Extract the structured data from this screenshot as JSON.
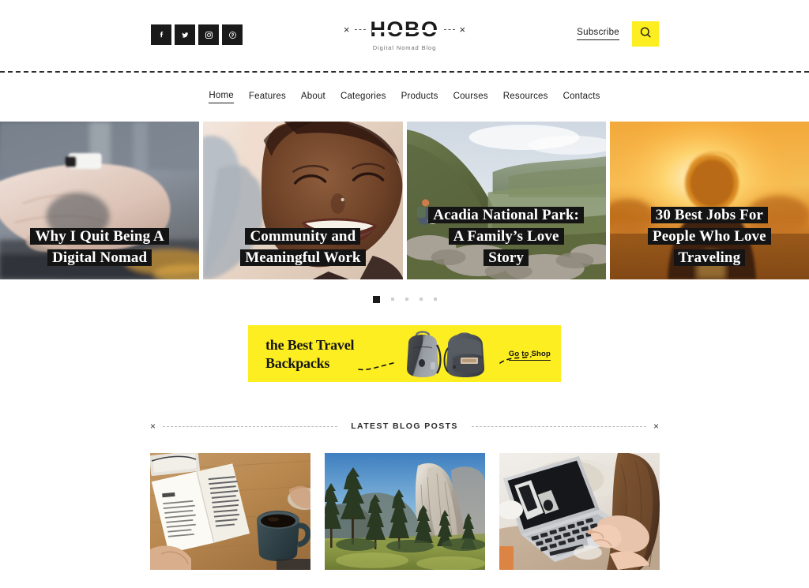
{
  "theme": {
    "accent": "#fdee21",
    "ink": "#1a1a1a",
    "muted": "#6f6f6f"
  },
  "header": {
    "social": [
      {
        "name": "facebook-icon",
        "label": "Facebook"
      },
      {
        "name": "twitter-icon",
        "label": "Twitter"
      },
      {
        "name": "instagram-icon",
        "label": "Instagram"
      },
      {
        "name": "pinterest-icon",
        "label": "Pinterest"
      }
    ],
    "logo": {
      "mark_left": "×",
      "mark_right": "×",
      "title": "HOBO",
      "tagline": "Digital Nomad Blog"
    },
    "subscribe_label": "Subscribe",
    "search_icon": "search-icon"
  },
  "nav": {
    "items": [
      {
        "label": "Home",
        "active": true
      },
      {
        "label": "Features",
        "active": false
      },
      {
        "label": "About",
        "active": false
      },
      {
        "label": "Categories",
        "active": false
      },
      {
        "label": "Products",
        "active": false
      },
      {
        "label": "Courses",
        "active": false
      },
      {
        "label": "Resources",
        "active": false
      },
      {
        "label": "Contacts",
        "active": false
      }
    ]
  },
  "hero": {
    "slides": [
      {
        "title_lines": [
          "Why I Quit Being A",
          "Digital Nomad"
        ],
        "image_alt": "hand-on-laptop-keyboard"
      },
      {
        "title_lines": [
          "Community and",
          "Meaningful Work"
        ],
        "image_alt": "smiling-woman-portrait"
      },
      {
        "title_lines": [
          "Acadia National Park:",
          "A Family’s Love",
          "Story"
        ],
        "image_alt": "hiker-on-green-mountain-valley"
      },
      {
        "title_lines": [
          "30 Best Jobs For",
          "People Who Love",
          "Traveling"
        ],
        "image_alt": "person-silhouette-at-sunset"
      }
    ],
    "dots": {
      "count": 5,
      "active_index": 0
    }
  },
  "promo": {
    "headline_lines": [
      "the Best Travel",
      "Backpacks"
    ],
    "cta_label": "Go to Shop",
    "image_alt": "two-grey-backpacks"
  },
  "section": {
    "divider_label": "LATEST BLOG POSTS",
    "divider_mark": "×"
  },
  "posts": [
    {
      "image_alt": "open-book-and-coffee-mug-on-wooden-desk"
    },
    {
      "image_alt": "yosemite-el-capitan-with-pine-trees"
    },
    {
      "image_alt": "woman-working-on-laptop"
    }
  ]
}
